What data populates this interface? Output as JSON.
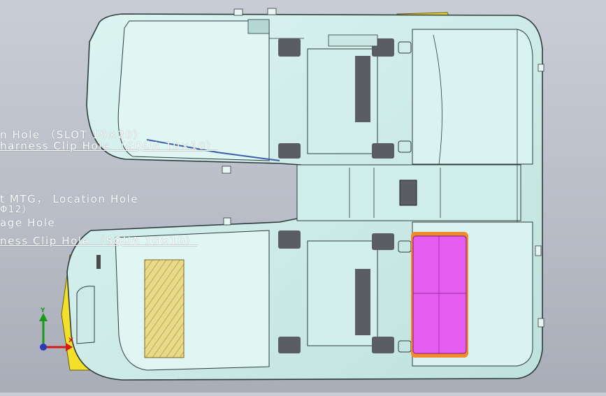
{
  "annotations": [
    {
      "id": "slot-hole",
      "text": "n Hole （SLOT 10×20）"
    },
    {
      "id": "harness-clip-upper",
      "text": "harness Clip Hole （SQUA 10×10）"
    },
    {
      "id": "mtg-location",
      "text": "t MTG， Location Hole"
    },
    {
      "id": "dia-12",
      "text": "Φ12）"
    },
    {
      "id": "drainage-hole",
      "text": "age Hole"
    },
    {
      "id": "harness-clip-lower",
      "text": "ness Clip Hole （SQUA 10×10）"
    }
  ],
  "triad": {
    "y_label": "Y",
    "x_label": "X"
  },
  "colors": {
    "background": "#bfc3cd",
    "panel_fill": "#d6f1ee",
    "panel_shade": "#9fc4c0",
    "panel_outline": "#2d3c3a",
    "dark_cutout": "#5a5d62",
    "yellow_part": "#f2e02a",
    "magenta_part": "#e45df0",
    "orange_edge": "#f08a2a",
    "hatch": "#d9c45a"
  }
}
